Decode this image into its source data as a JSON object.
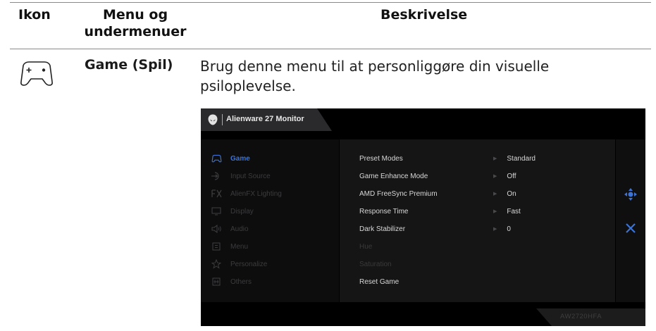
{
  "table": {
    "headers": {
      "icon": "Ikon",
      "menu_line1": "Menu og",
      "menu_line2": "undermenuer",
      "description": "Beskrivelse"
    },
    "row": {
      "icon": "gamepad-icon",
      "menu": "Game (Spil)",
      "description": "Brug denne menu til at personliggøre din visuelle psiloplevelse."
    }
  },
  "osd": {
    "title": "Alienware 27 Monitor",
    "model": "AW2720HFA",
    "accent_color": "#3c73d6",
    "menu_items": [
      {
        "icon": "gamepad-icon",
        "label": "Game",
        "active": true
      },
      {
        "icon": "input-source-icon",
        "label": "Input Source",
        "active": false
      },
      {
        "icon": "alienfx-icon",
        "label": "AlienFX Lighting",
        "active": false
      },
      {
        "icon": "display-icon",
        "label": "Display",
        "active": false
      },
      {
        "icon": "audio-icon",
        "label": "Audio",
        "active": false
      },
      {
        "icon": "menu-icon",
        "label": "Menu",
        "active": false
      },
      {
        "icon": "star-icon",
        "label": "Personalize",
        "active": false
      },
      {
        "icon": "others-icon",
        "label": "Others",
        "active": false
      }
    ],
    "sub_items": [
      {
        "label": "Preset Modes",
        "value": "Standard",
        "enabled": true
      },
      {
        "label": "Game Enhance Mode",
        "value": "Off",
        "enabled": true
      },
      {
        "label": "AMD FreeSync Premium",
        "value": "On",
        "enabled": true
      },
      {
        "label": "Response Time",
        "value": "Fast",
        "enabled": true
      },
      {
        "label": "Dark Stabilizer",
        "value": "0",
        "enabled": true
      },
      {
        "label": "Hue",
        "value": null,
        "enabled": false
      },
      {
        "label": "Saturation",
        "value": null,
        "enabled": false
      },
      {
        "label": "Reset Game",
        "value": null,
        "enabled": true
      }
    ],
    "side_buttons": [
      "navigate-icon",
      "close-icon"
    ]
  }
}
